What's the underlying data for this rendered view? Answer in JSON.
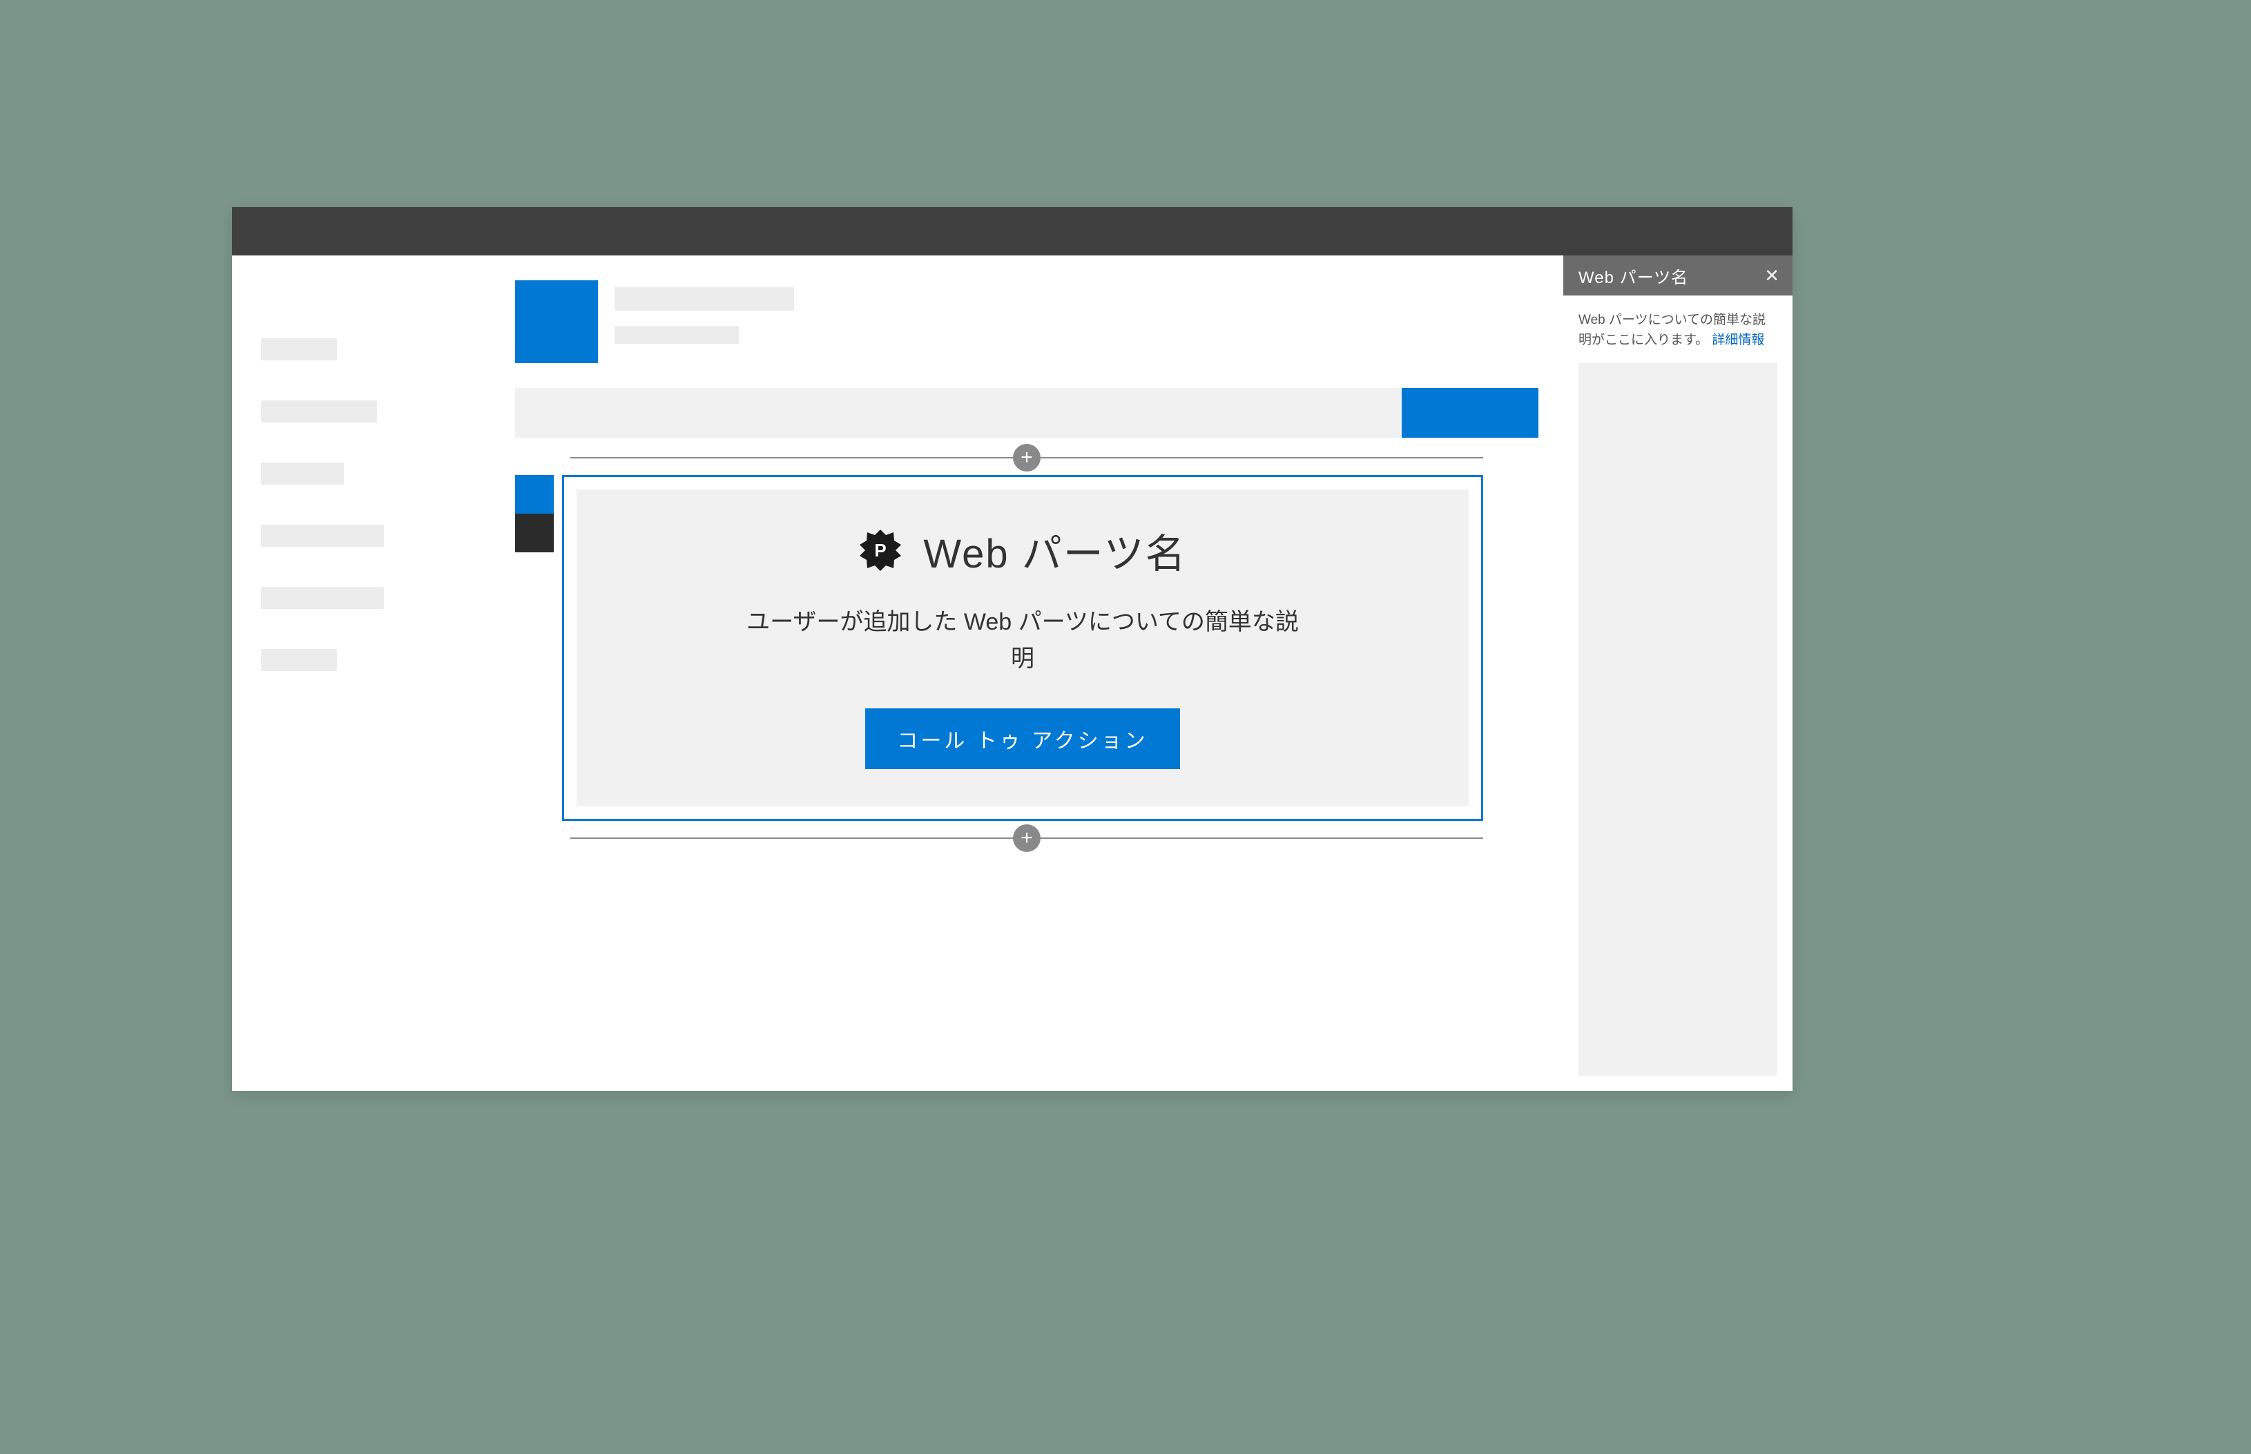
{
  "webpart": {
    "title": "Web パーツ名",
    "description": "ユーザーが追加した Web パーツについての簡単な説明",
    "cta_label": "コール トゥ アクション"
  },
  "property_pane": {
    "title": "Web パーツ名",
    "description_prefix": "Web パーツについての簡単な説明がここに入ります。",
    "learn_more": "詳細情報"
  },
  "icons": {
    "add": "+",
    "close": "✕",
    "badge_letter": "P"
  }
}
